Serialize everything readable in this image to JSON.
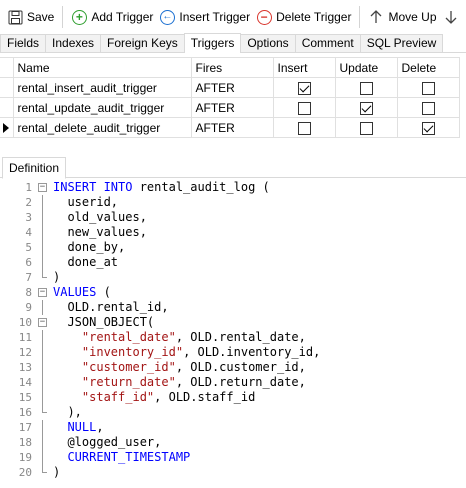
{
  "toolbar": {
    "save": "Save",
    "add_trigger": "Add Trigger",
    "insert_trigger": "Insert Trigger",
    "delete_trigger": "Delete Trigger",
    "move_up": "Move Up"
  },
  "tabs": [
    "Fields",
    "Indexes",
    "Foreign Keys",
    "Triggers",
    "Options",
    "Comment",
    "SQL Preview"
  ],
  "active_tab": "Triggers",
  "grid": {
    "headers": [
      "Name",
      "Fires",
      "Insert",
      "Update",
      "Delete"
    ],
    "rows": [
      {
        "name": "rental_insert_audit_trigger",
        "fires": "AFTER",
        "insert": true,
        "update": false,
        "delete": false
      },
      {
        "name": "rental_update_audit_trigger",
        "fires": "AFTER",
        "insert": false,
        "update": true,
        "delete": false
      },
      {
        "name": "rental_delete_audit_trigger",
        "fires": "AFTER",
        "insert": false,
        "update": false,
        "delete": true
      }
    ]
  },
  "definition_tab": "Definition",
  "code_lines": [
    [
      {
        "t": "kw",
        "v": "INSERT INTO"
      },
      {
        "t": "txt",
        "v": " rental_audit_log ("
      }
    ],
    [
      {
        "t": "txt",
        "v": "  userid,"
      }
    ],
    [
      {
        "t": "txt",
        "v": "  old_values,"
      }
    ],
    [
      {
        "t": "txt",
        "v": "  new_values,"
      }
    ],
    [
      {
        "t": "txt",
        "v": "  done_by,"
      }
    ],
    [
      {
        "t": "txt",
        "v": "  done_at"
      }
    ],
    [
      {
        "t": "txt",
        "v": ")"
      }
    ],
    [
      {
        "t": "kw",
        "v": "VALUES"
      },
      {
        "t": "txt",
        "v": " ("
      }
    ],
    [
      {
        "t": "txt",
        "v": "  OLD.rental_id,"
      }
    ],
    [
      {
        "t": "txt",
        "v": "  JSON_OBJECT("
      }
    ],
    [
      {
        "t": "txt",
        "v": "    "
      },
      {
        "t": "str",
        "v": "\"rental_date\""
      },
      {
        "t": "txt",
        "v": ", OLD.rental_date,"
      }
    ],
    [
      {
        "t": "txt",
        "v": "    "
      },
      {
        "t": "str",
        "v": "\"inventory_id\""
      },
      {
        "t": "txt",
        "v": ", OLD.inventory_id,"
      }
    ],
    [
      {
        "t": "txt",
        "v": "    "
      },
      {
        "t": "str",
        "v": "\"customer_id\""
      },
      {
        "t": "txt",
        "v": ", OLD.customer_id,"
      }
    ],
    [
      {
        "t": "txt",
        "v": "    "
      },
      {
        "t": "str",
        "v": "\"return_date\""
      },
      {
        "t": "txt",
        "v": ", OLD.return_date,"
      }
    ],
    [
      {
        "t": "txt",
        "v": "    "
      },
      {
        "t": "str",
        "v": "\"staff_id\""
      },
      {
        "t": "txt",
        "v": ", OLD.staff_id"
      }
    ],
    [
      {
        "t": "txt",
        "v": "  ),"
      }
    ],
    [
      {
        "t": "txt",
        "v": "  "
      },
      {
        "t": "kw",
        "v": "NULL"
      },
      {
        "t": "txt",
        "v": ","
      }
    ],
    [
      {
        "t": "txt",
        "v": "  @logged_user,"
      }
    ],
    [
      {
        "t": "txt",
        "v": "  "
      },
      {
        "t": "kw",
        "v": "CURRENT_TIMESTAMP"
      }
    ],
    [
      {
        "t": "txt",
        "v": ")"
      }
    ]
  ],
  "line_numbers": [
    "1",
    "2",
    "3",
    "4",
    "5",
    "6",
    "7",
    "8",
    "9",
    "10",
    "11",
    "12",
    "13",
    "14",
    "15",
    "16",
    "17",
    "18",
    "19",
    "20"
  ],
  "colors": {
    "keyword": "#0000ff",
    "string": "#a31515",
    "add_icon": "#2e9e2e",
    "insert_icon": "#1a6fd1",
    "delete_icon": "#d9352c"
  },
  "icons": [
    "save-icon",
    "add-icon",
    "insert-icon",
    "delete-icon",
    "arrow-up-icon",
    "arrow-down-icon"
  ]
}
